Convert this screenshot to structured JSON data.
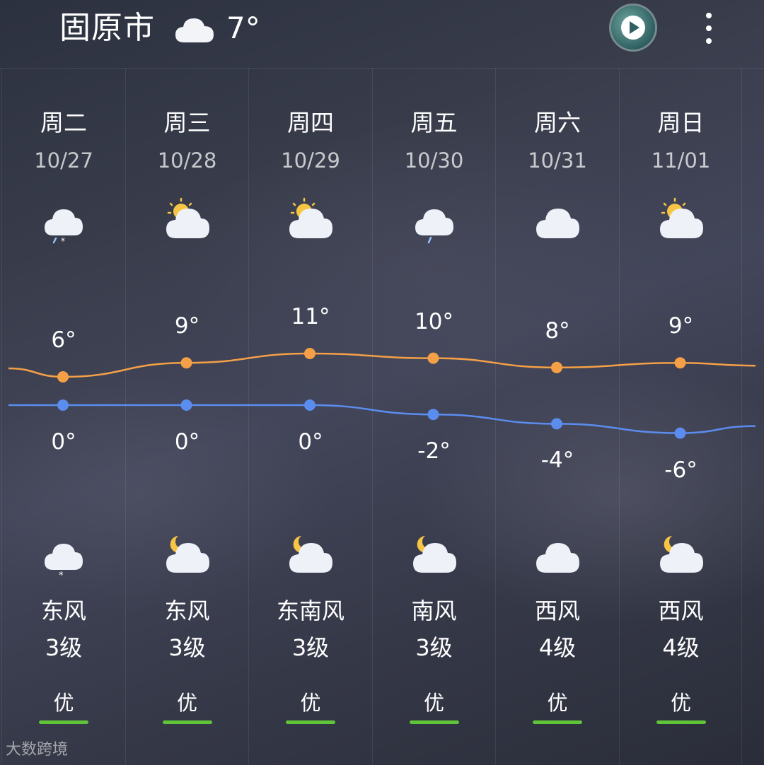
{
  "header": {
    "city": "固原市",
    "current_icon": "cloudy-icon",
    "current_temp": "7°",
    "play_icon": "play-icon",
    "menu_icon": "more-vertical-icon"
  },
  "forecast": [
    {
      "day": "周二",
      "date": "10/27",
      "day_icon": "rain-snow-icon",
      "high": "6°",
      "low": "0°",
      "night_icon": "snow-icon",
      "wind_dir": "东风",
      "wind_level": "3级",
      "aqi": "优",
      "high_val": 6,
      "low_val": 0
    },
    {
      "day": "周三",
      "date": "10/28",
      "day_icon": "partly-cloudy-day-icon",
      "high": "9°",
      "low": "0°",
      "night_icon": "partly-cloudy-night-icon",
      "wind_dir": "东风",
      "wind_level": "3级",
      "aqi": "优",
      "high_val": 9,
      "low_val": 0
    },
    {
      "day": "周四",
      "date": "10/29",
      "day_icon": "partly-cloudy-day-icon",
      "high": "11°",
      "low": "0°",
      "night_icon": "partly-cloudy-night-icon",
      "wind_dir": "东南风",
      "wind_level": "3级",
      "aqi": "优",
      "high_val": 11,
      "low_val": 0
    },
    {
      "day": "周五",
      "date": "10/30",
      "day_icon": "light-rain-icon",
      "high": "10°",
      "low": "-2°",
      "night_icon": "partly-cloudy-night-icon",
      "wind_dir": "南风",
      "wind_level": "3级",
      "aqi": "优",
      "high_val": 10,
      "low_val": -2
    },
    {
      "day": "周六",
      "date": "10/31",
      "day_icon": "cloudy-icon",
      "high": "8°",
      "low": "-4°",
      "night_icon": "cloudy-icon",
      "wind_dir": "西风",
      "wind_level": "4级",
      "aqi": "优",
      "high_val": 8,
      "low_val": -4
    },
    {
      "day": "周日",
      "date": "11/01",
      "day_icon": "partly-cloudy-day-icon",
      "high": "9°",
      "low": "-6°",
      "night_icon": "partly-cloudy-night-icon",
      "wind_dir": "西风",
      "wind_level": "4级",
      "aqi": "优",
      "high_val": 9,
      "low_val": -6
    }
  ],
  "colors": {
    "high_line": "#f5a047",
    "low_line": "#5b8def",
    "aqi_good": "#5fc437"
  },
  "watermark": "大数跨境"
}
